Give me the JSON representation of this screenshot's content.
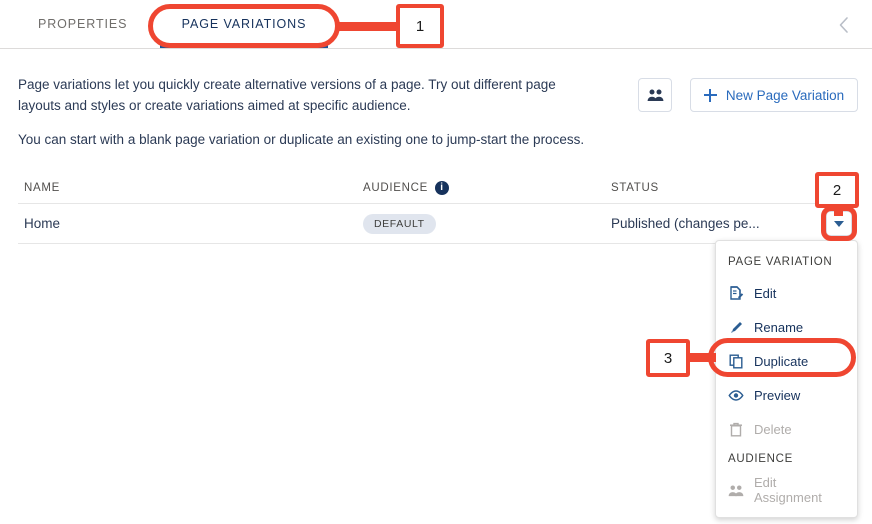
{
  "tabs": [
    {
      "id": "properties",
      "label": "PROPERTIES",
      "active": false
    },
    {
      "id": "page-variations",
      "label": "PAGE VARIATIONS",
      "active": true
    }
  ],
  "collapse": {
    "icon": "chevron-left-icon"
  },
  "intro": {
    "paragraph1": "Page variations let you quickly create alternative versions of a page. Try out different page layouts and styles or create variations aimed at specific audience.",
    "paragraph2": "You can start with a blank page variation or duplicate an existing one to jump-start the process."
  },
  "actions": {
    "audience_icon": "people-group-icon",
    "new_variation_label": "New Page Variation",
    "new_variation_icon": "plus-icon"
  },
  "table": {
    "columns": {
      "name": "NAME",
      "audience": "AUDIENCE",
      "audience_info_icon": "info-icon",
      "status": "STATUS"
    },
    "rows": [
      {
        "name": "Home",
        "audience_badge": "DEFAULT",
        "status": "Published (changes pe...",
        "row_menu_icon": "chevron-down-icon"
      }
    ]
  },
  "menu": {
    "section1_label": "PAGE VARIATION",
    "items": [
      {
        "label": "Edit",
        "icon": "edit-document-icon",
        "disabled": false
      },
      {
        "label": "Rename",
        "icon": "pencil-icon",
        "disabled": false
      },
      {
        "label": "Duplicate",
        "icon": "copy-icon",
        "disabled": false
      },
      {
        "label": "Preview",
        "icon": "eye-icon",
        "disabled": false
      },
      {
        "label": "Delete",
        "icon": "trash-icon",
        "disabled": true
      }
    ],
    "section2_label": "AUDIENCE",
    "items2": [
      {
        "label": "Edit Assignment",
        "icon": "people-group-icon",
        "disabled": true
      }
    ]
  },
  "annotations": [
    {
      "number": "1",
      "target": "page-variations-tab"
    },
    {
      "number": "2",
      "target": "row-dropdown-button"
    },
    {
      "number": "3",
      "target": "duplicate-menu-item"
    }
  ],
  "colors": {
    "annotation": "#ef4631",
    "tab_active_underline": "#1b5297",
    "link_blue": "#2a6bbd",
    "badge_bg": "#e0e5ee",
    "text_navy": "#16325c"
  }
}
